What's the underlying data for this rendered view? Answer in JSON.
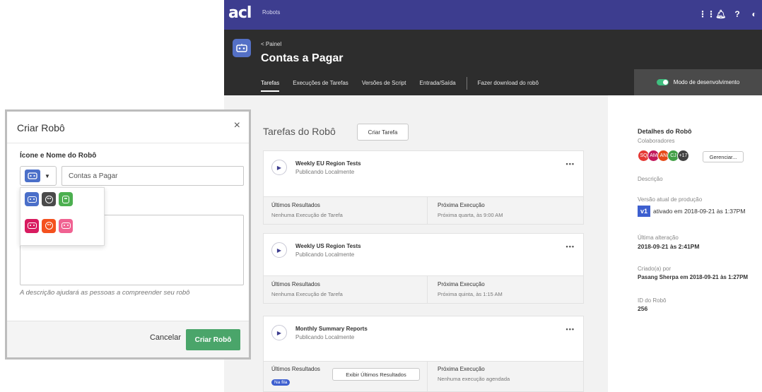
{
  "topbar": {
    "logo": "acl",
    "app_name": "Robots"
  },
  "header": {
    "back_label": "< Painel",
    "title": "Contas a Pagar",
    "tabs": [
      {
        "label": "Tarefas",
        "active": true
      },
      {
        "label": "Execuções de Tarefas"
      },
      {
        "label": "Versões de Script"
      },
      {
        "label": "Entrada/Saída"
      },
      {
        "label": "Fazer download do robô"
      }
    ],
    "dev_mode_label": "Modo de desenvolvimento"
  },
  "tasks": {
    "heading": "Tarefas do Robô",
    "create_button": "Criar Tarefa",
    "cards": [
      {
        "name": "Weekly EU Region Tests",
        "status": "Publicando Localmente",
        "last_label": "Últimos Resultados",
        "last_value": "Nenhuma Execução de Tarefa",
        "next_label": "Próxima Execução",
        "next_value": "Próxima quarta, às 9:00 AM"
      },
      {
        "name": "Weekly US Region Tests",
        "status": "Publicando Localmente",
        "last_label": "Últimos Resultados",
        "last_value": "Nenhuma Execução de Tarefa",
        "next_label": "Próxima Execução",
        "next_value": "Próxima quinta, às 1:15 AM"
      },
      {
        "name": "Monthly Summary Reports",
        "status": "Publicando Localmente",
        "last_label": "Últimos Resultados",
        "queue_badge": "Na fila",
        "view_button": "Exibir Últimos Resultados",
        "next_label": "Próxima Execução",
        "next_value": "Nenhuma execução agendada"
      }
    ],
    "more_label": "•••"
  },
  "details": {
    "heading": "Detalhes do Robô",
    "collaborators_label": "Colaboradores",
    "collaborators": [
      "SQ",
      "AM",
      "AN",
      "CJ",
      "+17"
    ],
    "manage_button": "Gerenciar...",
    "description_label": "Descrição",
    "prod_version_label": "Versão atual de produção",
    "prod_version_badge": "v1",
    "prod_version_text": "ativado em 2018-09-21 às 1:37PM",
    "modified_label": "Última alteração",
    "modified_value": "2018-09-21 às 2:41PM",
    "created_label": "Criado(a) por",
    "created_value": "Pasang Sherpa em 2018-09-21 às 1:27PM",
    "id_label": "ID do Robô",
    "id_value": "256"
  },
  "dialog": {
    "title": "Criar Robô",
    "close": "×",
    "field_label": "Ícone e Nome do Robô",
    "name_value": "Contas a Pagar",
    "helper": "A descrição ajudará as pessoas a compreender seu robô",
    "cancel": "Cancelar",
    "submit": "Criar Robô",
    "icon_colors": [
      "#4a6fc9",
      "#4a4a4a",
      "#4caf50",
      "#d81b60",
      "#f4511e",
      "#f06292"
    ]
  },
  "colors": {
    "topbar": "#3d3d8f",
    "header": "#2d2d2d",
    "primary": "#4aa56a",
    "accent": "#3d5fcf"
  }
}
